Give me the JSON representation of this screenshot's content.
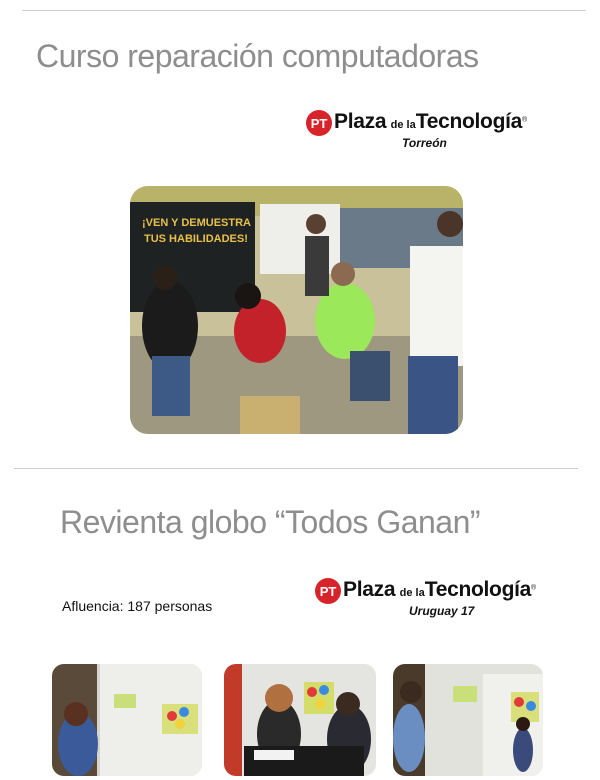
{
  "section1": {
    "title": "Curso reparación computadoras",
    "logo": {
      "mark": "PT",
      "name_plaza": "Plaza",
      "name_dela": "de la",
      "name_tecnologia": "Tecnología",
      "registered": "®",
      "location": "Torreón",
      "brand_color": "#d8232a"
    },
    "photo": {
      "banner_line1": "¡VEN Y DEMUESTRA",
      "banner_line2": "TUS HABILIDADES!"
    }
  },
  "section2": {
    "title": "Revienta globo “Todos Ganan”",
    "attendance": "Afluencia: 187 personas",
    "logo": {
      "mark": "PT",
      "name_plaza": "Plaza",
      "name_dela": "de la",
      "name_tecnologia": "Tecnología",
      "registered": "®",
      "location": "Uruguay 17",
      "brand_color": "#d8232a"
    }
  }
}
